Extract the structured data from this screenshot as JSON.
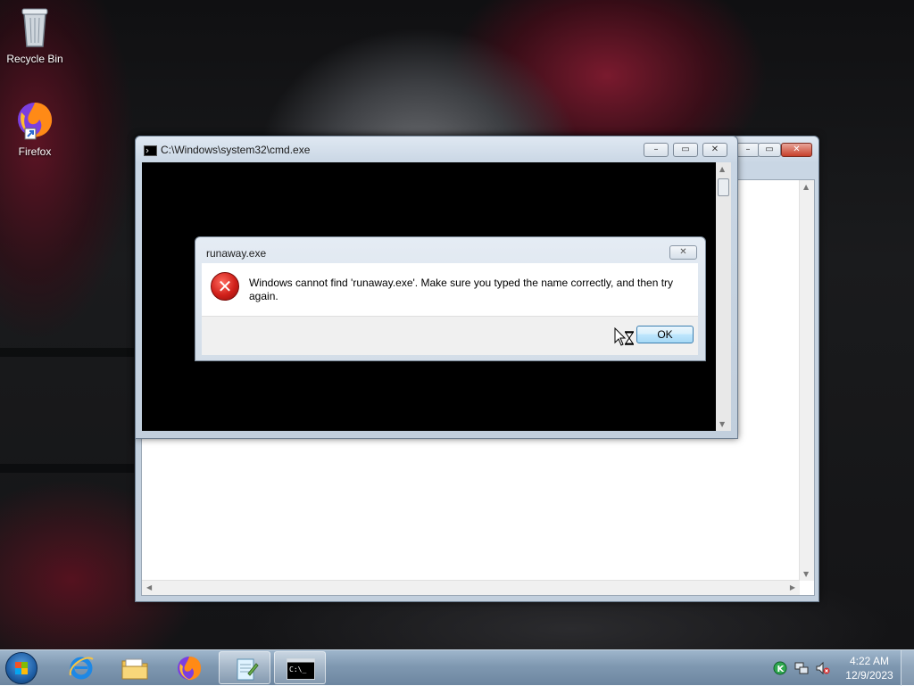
{
  "desktop": {
    "icons": [
      {
        "label": "Recycle Bin",
        "icon": "recycle-bin-icon"
      },
      {
        "label": "Firefox",
        "icon": "firefox-icon"
      }
    ]
  },
  "notepad_window": {
    "buttons": {
      "minimize": "minimize-icon",
      "maximize": "maximize-icon",
      "close": "close-icon"
    }
  },
  "cmd_window": {
    "title": "C:\\Windows\\system32\\cmd.exe",
    "buttons": {
      "minimize": "minimize-icon",
      "maximize": "maximize-icon",
      "close": "close-icon"
    }
  },
  "dialog": {
    "title": "runaway.exe",
    "message": "Windows cannot find 'runaway.exe'. Make sure you typed the name correctly, and then try again.",
    "icon": "error-icon",
    "ok_label": "OK"
  },
  "taskbar": {
    "pinned": [
      "internet-explorer-icon",
      "file-explorer-icon",
      "firefox-icon",
      "notepad-icon",
      "cmd-icon"
    ],
    "cmd_icon_text": "C:\\_",
    "tray": [
      "kaspersky-icon",
      "network-icon",
      "volume-muted-icon"
    ],
    "clock": {
      "time": "4:22 AM",
      "date": "12/9/2023"
    }
  }
}
